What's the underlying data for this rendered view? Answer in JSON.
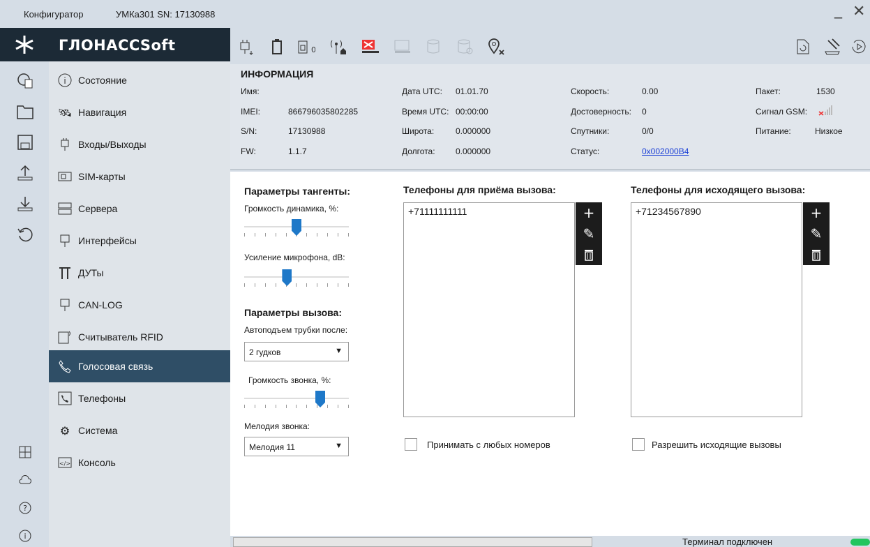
{
  "window": {
    "app_label": "Конфигуратор",
    "device_title": "УМКа301 SN: 17130988",
    "minimize": "_",
    "close": "✕"
  },
  "brand": "ГЛОНАССSoft",
  "nav": {
    "items": [
      {
        "label": "Состояние",
        "icon": "info-icon"
      },
      {
        "label": "Навигация",
        "icon": "satellite-icon"
      },
      {
        "label": "Входы/Выходы",
        "icon": "plug-icon"
      },
      {
        "label": "SIM-карты",
        "icon": "sim-icon"
      },
      {
        "label": "Сервера",
        "icon": "server-icon"
      },
      {
        "label": "Интерфейсы",
        "icon": "connector-icon"
      },
      {
        "label": "ДУТы",
        "icon": "fuel-sensor-icon"
      },
      {
        "label": "CAN-LOG",
        "icon": "connector-icon"
      },
      {
        "label": "Считыватель RFID",
        "icon": "rfid-icon"
      },
      {
        "label": "Голосовая связь",
        "icon": "phone-icon",
        "active": true
      },
      {
        "label": "Телефоны",
        "icon": "phonebook-icon"
      },
      {
        "label": "Система",
        "icon": "gear-icon"
      },
      {
        "label": "Консоль",
        "icon": "console-icon"
      }
    ]
  },
  "info": {
    "title": "ИНФОРМАЦИЯ",
    "name_label": "Имя:",
    "name_value": "",
    "imei_label": "IMEI:",
    "imei_value": "866796035802285",
    "sn_label": "S/N:",
    "sn_value": "17130988",
    "fw_label": "FW:",
    "fw_value": "1.1.7",
    "date_label": "Дата UTC:",
    "date_value": "01.01.70",
    "time_label": "Время UTC:",
    "time_value": "00:00:00",
    "lat_label": "Широта:",
    "lat_value": "0.000000",
    "lon_label": "Долгота:",
    "lon_value": "0.000000",
    "speed_label": "Скорость:",
    "speed_value": "0.00",
    "valid_label": "Достоверность:",
    "valid_value": "0",
    "sats_label": "Спутники:",
    "sats_value": "0/0",
    "status_label": "Статус:",
    "status_value": "0x002000B4",
    "packet_label": "Пакет:",
    "packet_value": "1530",
    "gsm_label": "Сигнал GSM:",
    "power_label": "Питание:",
    "power_value": "Низкое"
  },
  "voice": {
    "headset_title": "Параметры тангенты:",
    "speaker_label": "Громкость динамика, %:",
    "speaker_level": 0.5,
    "mic_label": "Усиление микрофона, dB:",
    "mic_level": 0.4,
    "call_title": "Параметры вызова:",
    "autoanswer_label": "Автоподъем трубки после:",
    "autoanswer_value": "2 гудков",
    "ring_volume_label": "Громкость звонка, %:",
    "ring_level": 0.75,
    "melody_label": "Мелодия звонка:",
    "melody_value": "Мелодия 11"
  },
  "incoming": {
    "title": "Телефоны для приёма вызова:",
    "numbers": [
      "+71111111111"
    ],
    "accept_any_label": "Принимать с любых номеров"
  },
  "outgoing": {
    "title": "Телефоны для исходящего вызова:",
    "numbers": [
      "+71234567890"
    ],
    "allow_label": "Разрешить исходящие вызовы"
  },
  "list_tools": {
    "add": "+",
    "edit": "✎",
    "delete": "🗑"
  },
  "status": {
    "text": "Терминал подключен",
    "led_color": "#22c55e"
  }
}
